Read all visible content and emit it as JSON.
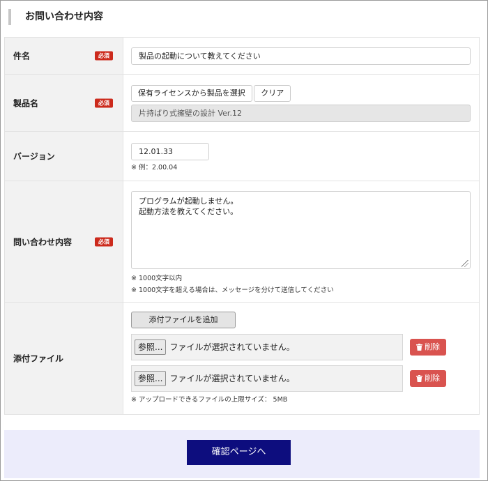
{
  "section_title": "お問い合わせ内容",
  "required_badge": "必須",
  "subject": {
    "label": "件名",
    "value": "製品の起動について教えてください"
  },
  "product": {
    "label": "製品名",
    "select_button": "保有ライセンスから製品を選択",
    "clear_button": "クリア",
    "value": "片持ばり式擁壁の設計 Ver.12"
  },
  "version": {
    "label": "バージョン",
    "value": "12.01.33",
    "example": "※ 例：2.00.04"
  },
  "inquiry": {
    "label": "問い合わせ内容",
    "lines": [
      "プログラムが起動しません。",
      "起動方法を教えてください。"
    ],
    "note1": "※ 1000文字以内",
    "note2": "※ 1000文字を超える場合は、メッセージを分けて送信してください"
  },
  "attachment": {
    "label": "添付ファイル",
    "add_button": "添付ファイルを追加",
    "files": [
      {
        "browse": "参照...",
        "status": "ファイルが選択されていません。",
        "delete": "削除"
      },
      {
        "browse": "参照...",
        "status": "ファイルが選択されていません。",
        "delete": "削除"
      }
    ],
    "note": "※ アップロードできるファイルの上限サイズ： 5MB"
  },
  "submit_button": "確認ページへ",
  "colors": {
    "required": "#cc2a1c",
    "delete": "#d9534f",
    "submit": "#0d0d7e",
    "footer_bg": "#ececfb"
  }
}
